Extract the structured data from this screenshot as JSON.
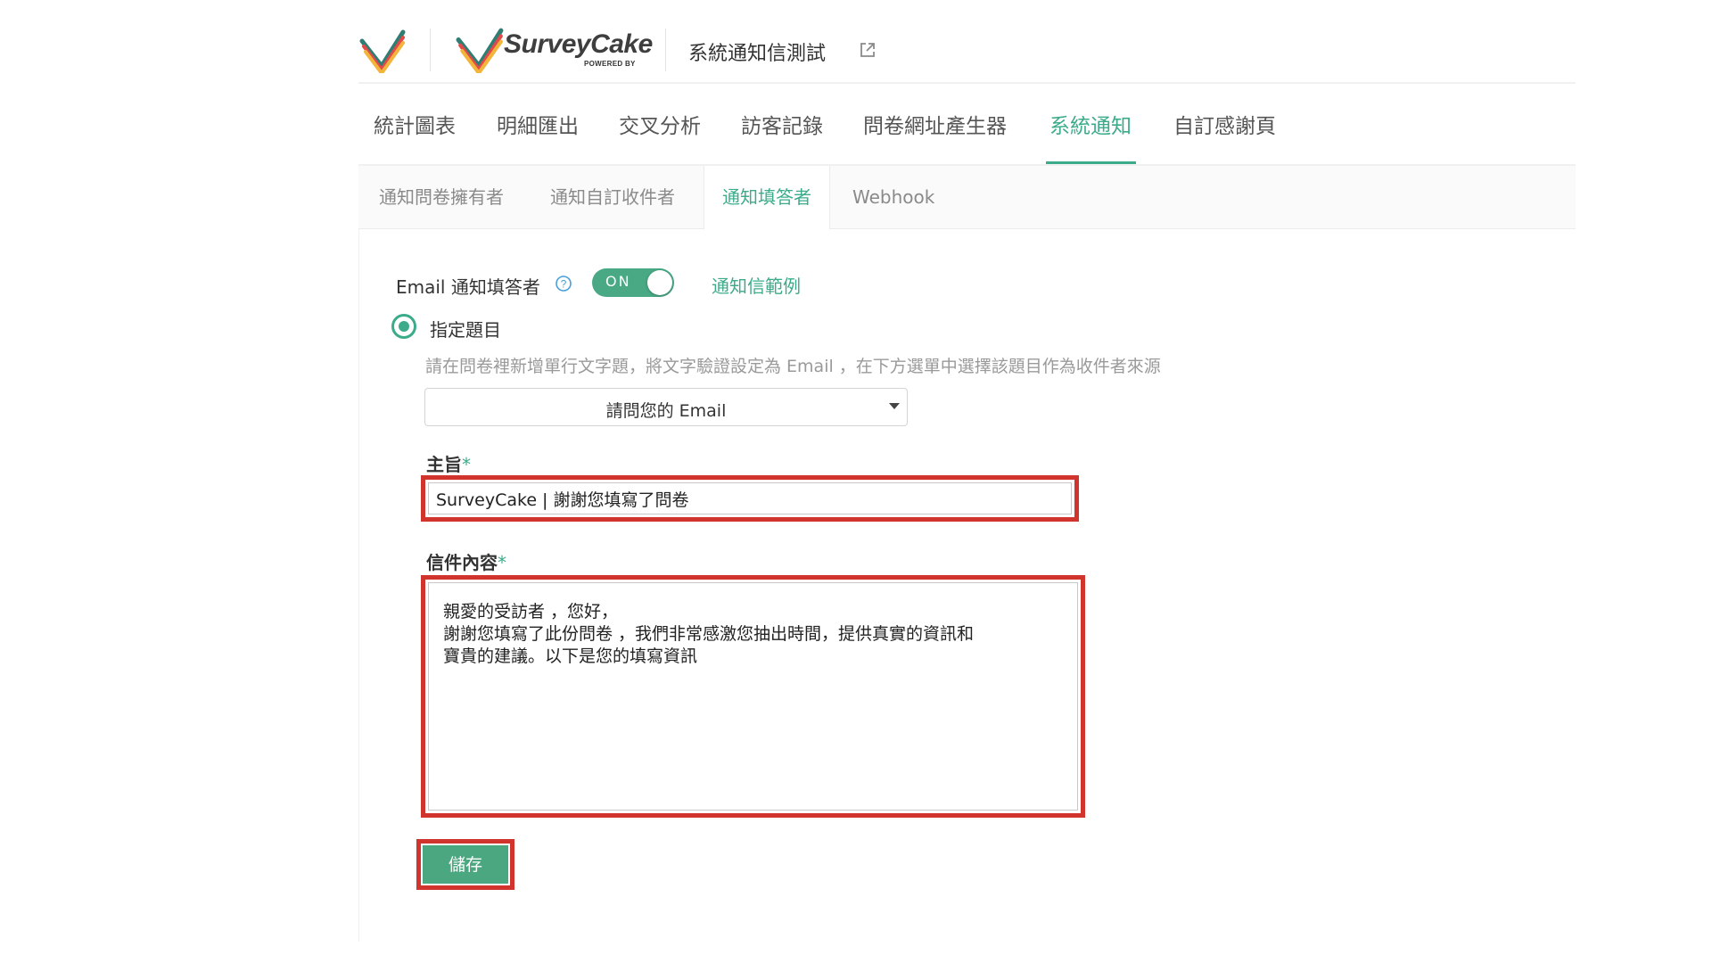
{
  "header": {
    "brand_name": "SurveyCake",
    "brand_sub": "POWERED BY",
    "survey_title": "系統通知信測試"
  },
  "main_tabs": [
    {
      "label": "統計圖表"
    },
    {
      "label": "明細匯出"
    },
    {
      "label": "交叉分析"
    },
    {
      "label": "訪客記錄"
    },
    {
      "label": "問卷網址產生器"
    },
    {
      "label": "系統通知",
      "active": true
    },
    {
      "label": "自訂感謝頁"
    }
  ],
  "sub_tabs": [
    {
      "label": "通知問卷擁有者"
    },
    {
      "label": "通知自訂收件者"
    },
    {
      "label": "通知填答者",
      "active": true
    },
    {
      "label": "Webhook"
    }
  ],
  "notify": {
    "label": "Email 通知填答者",
    "toggle_label": "ON",
    "example_link": "通知信範例"
  },
  "radio": {
    "label": "指定題目"
  },
  "hint": "請在問卷裡新增單行文字題，將文字驗證設定為 Email ，在下方選單中選擇該題目作為收件者來源",
  "select": {
    "value": "請問您的 Email"
  },
  "subject": {
    "label": "主旨",
    "required_mark": "*",
    "value": "SurveyCake | 謝謝您填寫了問卷"
  },
  "body": {
    "label": "信件內容",
    "required_mark": "*",
    "value": "親愛的受訪者 ，您好，\n謝謝您填寫了此份問卷 ，我們非常感激您抽出時間，提供真實的資訊和\n寶貴的建議。以下是您的填寫資訊"
  },
  "save": {
    "label": "儲存"
  },
  "colors": {
    "accent": "#3cab8a",
    "toggle_on": "#48a984",
    "save_button": "#4aa780",
    "highlight_border": "#d0342c"
  },
  "icons": {
    "logo": "surveycake-check-logo-icon",
    "external": "external-link-icon",
    "help": "help-icon",
    "caret": "caret-down-icon"
  }
}
